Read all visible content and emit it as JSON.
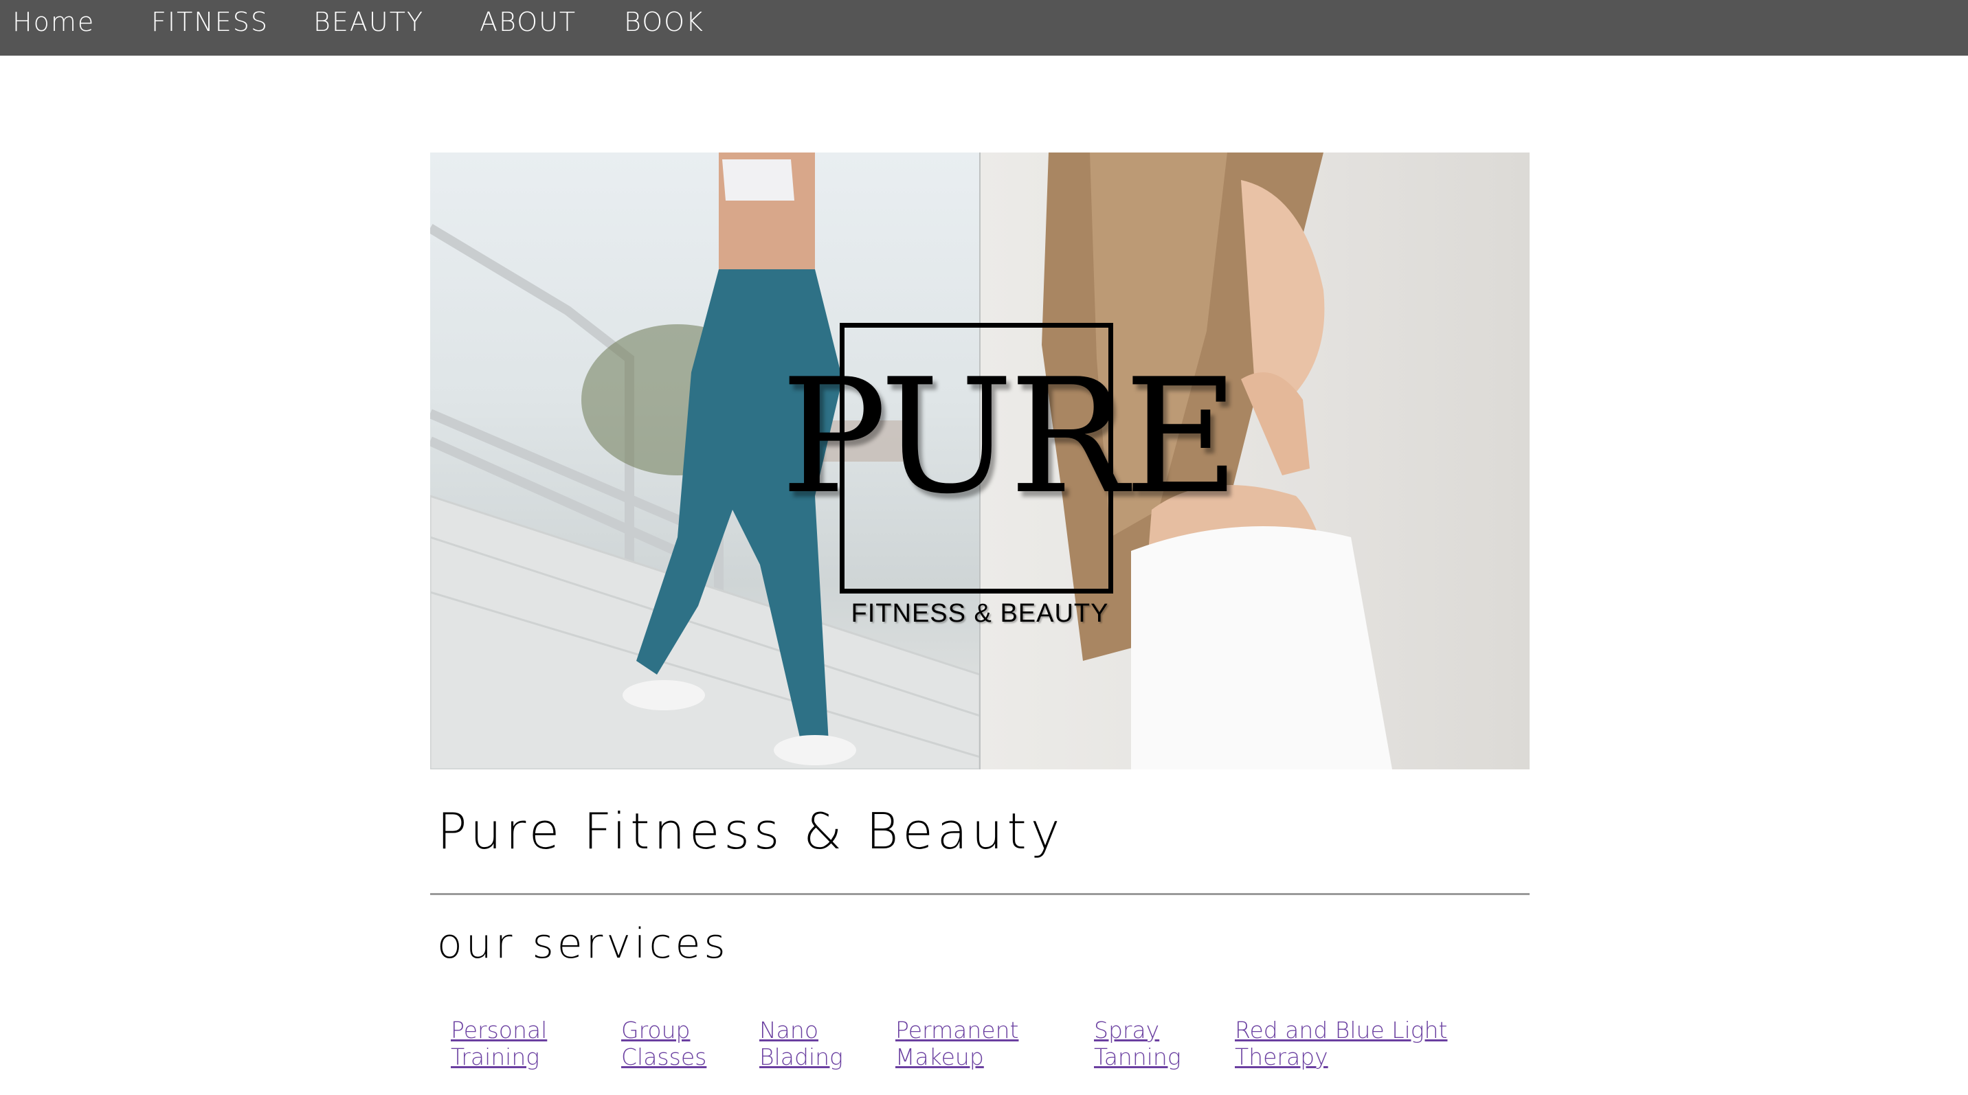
{
  "nav": {
    "items": [
      {
        "label": "Home"
      },
      {
        "label": "FITNESS"
      },
      {
        "label": "BEAUTY"
      },
      {
        "label": "ABOUT"
      },
      {
        "label": "BOOK"
      }
    ]
  },
  "hero": {
    "logo_word": "PURE",
    "logo_subtitle": "FITNESS & BEAUTY"
  },
  "main": {
    "title": "Pure Fitness & Beauty",
    "services_heading": "our services",
    "services": [
      {
        "line1": "Personal",
        "line2": "Training"
      },
      {
        "line1": "Group",
        "line2": "Classes"
      },
      {
        "line1": "Nano",
        "line2": "Blading"
      },
      {
        "line1": "Permanent",
        "line2": "Makeup"
      },
      {
        "line1": "Spray",
        "line2": "Tanning"
      },
      {
        "line1": "Red and Blue Light",
        "line2": "Therapy"
      }
    ]
  },
  "colors": {
    "nav_bg": "#555555",
    "link": "#6a3fa0"
  }
}
